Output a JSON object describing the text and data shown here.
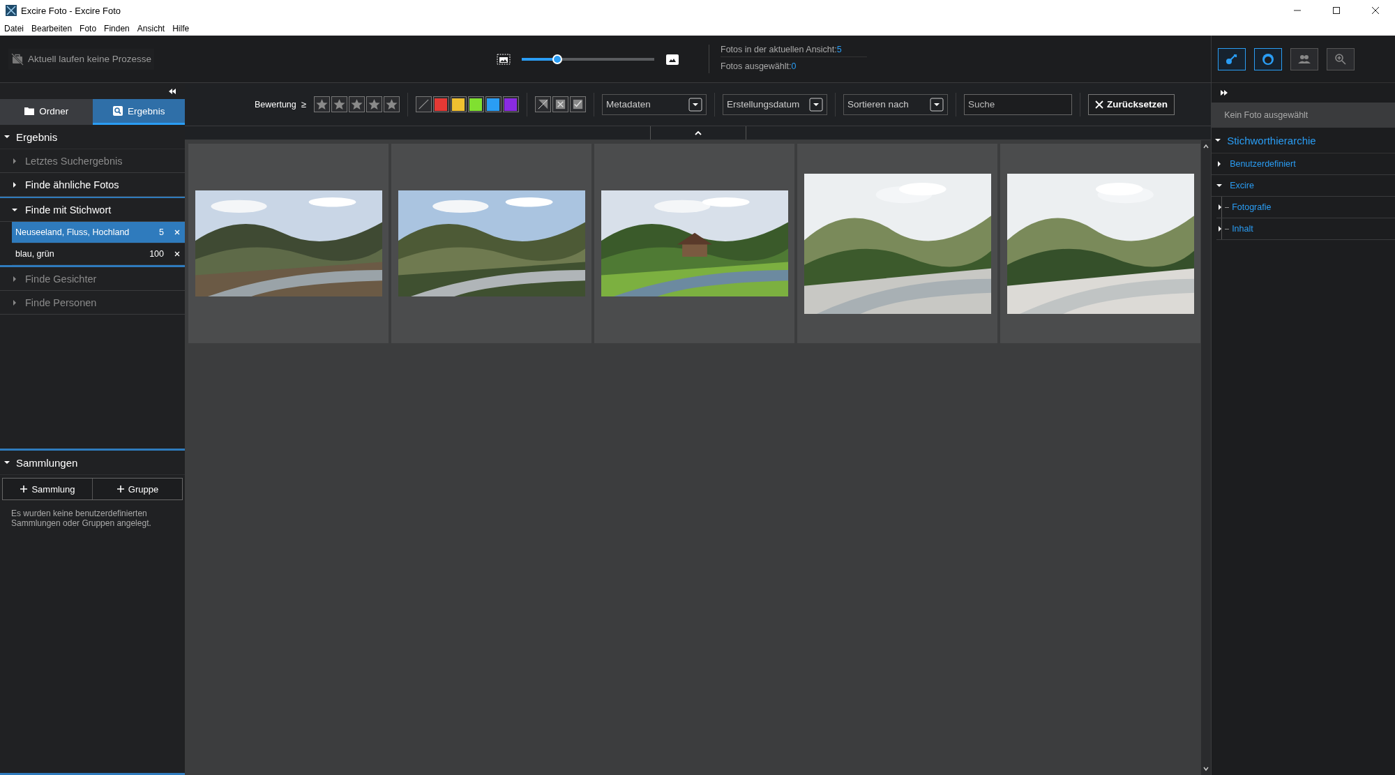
{
  "window": {
    "title": "Excire Foto - Excire Foto"
  },
  "menu": [
    "Datei",
    "Bearbeiten",
    "Foto",
    "Finden",
    "Ansicht",
    "Hilfe"
  ],
  "process_status": "Aktuell laufen keine Prozesse",
  "thumbnail_size": {
    "level": 0.27
  },
  "stats": [
    {
      "label": "Fotos in der aktuellen Ansicht:",
      "value": "5"
    },
    {
      "label": "Fotos ausgewählt:",
      "value": "0"
    }
  ],
  "tool_buttons": [
    {
      "selected": true
    },
    {
      "selected": true
    },
    {
      "selected": false
    },
    {
      "selected": false
    }
  ],
  "sidebar": {
    "tabs": [
      {
        "label": "Ordner",
        "selected": false
      },
      {
        "label": "Ergebnis",
        "selected": true
      }
    ],
    "section": {
      "title": "Ergebnis",
      "expanded": true
    },
    "items": [
      {
        "label": "Letztes Suchergebnis",
        "disabled": true,
        "expanded": false,
        "selected": false
      },
      {
        "label": "Finde ähnliche Fotos",
        "disabled": false,
        "expanded": false,
        "selected": false
      },
      {
        "label": "Finde mit Stichwort",
        "disabled": false,
        "expanded": true,
        "selected": true,
        "children": [
          {
            "label": "Neuseeland, Fluss, Hochland",
            "count": "5",
            "selected": true
          },
          {
            "label": "blau, grün",
            "count": "100",
            "selected": false
          }
        ]
      },
      {
        "label": "Finde Gesichter",
        "disabled": true,
        "expanded": false,
        "selected": false
      },
      {
        "label": "Finde Personen",
        "disabled": true,
        "expanded": false,
        "selected": false
      }
    ],
    "collections": {
      "title": "Sammlungen",
      "expanded": true,
      "buttons": [
        "Sammlung",
        "Gruppe"
      ],
      "note": "Es wurden keine benutzerdefinierten Sammlungen oder Gruppen angelegt."
    }
  },
  "filter_bar": {
    "rating_label": "Bewertung",
    "rating_operator": "≥",
    "color_labels": [
      {
        "color": "#e53935"
      },
      {
        "color": "#f0c030"
      },
      {
        "color": "#80e030"
      },
      {
        "color": "#2a9df4"
      },
      {
        "color": "#8a2be2"
      }
    ],
    "dropdowns": [
      "Metadaten",
      "Erstellungsdatum",
      "Sortieren nach"
    ],
    "search": {
      "placeholder": "Suche"
    },
    "reset_button": "Zurücksetzen"
  },
  "right_panel": {
    "info": "Kein Foto ausgewählt",
    "tree": {
      "title": "Stichworthierarchie",
      "expanded": true,
      "children": [
        {
          "label": "Benutzerdefiniert",
          "expanded": false
        },
        {
          "label": "Excire",
          "expanded": true,
          "children": [
            {
              "label": "Fotografie",
              "expanded": false
            },
            {
              "label": "Inhalt",
              "expanded": false
            }
          ]
        }
      ]
    }
  }
}
